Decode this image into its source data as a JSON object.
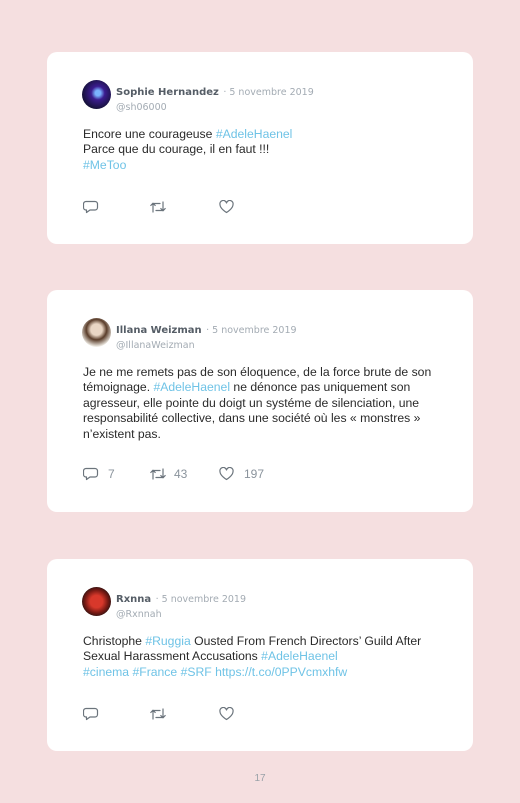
{
  "tweets": [
    {
      "name": "Sophie Hernandez",
      "date": "· 5 novembre 2019",
      "handle": "@sh06000",
      "line1_prefix": "Encore une courageuse ",
      "line1_tag": "#AdeleHaenel",
      "line2": "Parce que du courage, il en faut !!!",
      "line3_tag": "#MeToo",
      "replies": "",
      "retweets": "",
      "likes": ""
    },
    {
      "name": "Illana Weizman",
      "date": "· 5 novembre 2019",
      "handle": "@IllanaWeizman",
      "text_a": "Je ne me remets pas de son éloquence, de la force brute de son témoignage. ",
      "tag_a": "#AdeleHaenel",
      "text_b": " ne dénonce pas uniquement son agresseur, elle pointe du doigt un systéme de silenciation, une responsabilité collective, dans une société où les « monstres » n’existent pas.",
      "replies": "7",
      "retweets": "43",
      "likes": "197"
    },
    {
      "name": "Rxnna",
      "date": "· 5 novembre 2019",
      "handle": "@Rxnnah",
      "text_a": "Christophe ",
      "tag_a": "#Ruggia",
      "text_b": " Ousted From French Directors’ Guild After Sexual Harassment Accusations ",
      "tag_b": "#AdeleHaenel",
      "tag_c": "#cinema",
      "tag_d": "#France",
      "tag_e": "#SRF",
      "link": "https://t.co/0PPVcmxhfw",
      "replies": "",
      "retweets": "",
      "likes": ""
    }
  ],
  "page_number": "17",
  "colors": {
    "background": "#f5dfe0",
    "hashtag": "#6fc3e6",
    "card": "#ffffff"
  },
  "icons": [
    "reply-icon",
    "retweet-icon",
    "like-icon"
  ]
}
